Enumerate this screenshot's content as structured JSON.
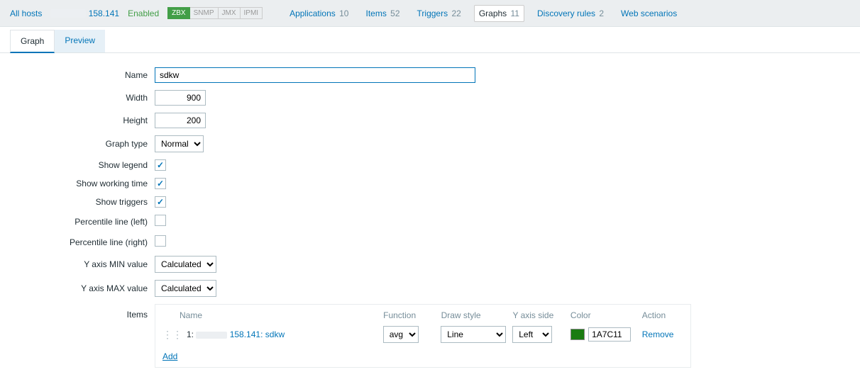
{
  "header": {
    "all_hosts": "All hosts",
    "host_suffix": "158.141",
    "enabled": "Enabled",
    "badges": [
      "ZBX",
      "SNMP",
      "JMX",
      "IPMI"
    ],
    "nav": [
      {
        "label": "Applications",
        "count": "10"
      },
      {
        "label": "Items",
        "count": "52"
      },
      {
        "label": "Triggers",
        "count": "22"
      },
      {
        "label": "Graphs",
        "count": "11",
        "active": true
      },
      {
        "label": "Discovery rules",
        "count": "2"
      },
      {
        "label": "Web scenarios",
        "count": ""
      }
    ]
  },
  "tabs": {
    "graph": "Graph",
    "preview": "Preview"
  },
  "form": {
    "name_label": "Name",
    "name_value": "sdkw",
    "width_label": "Width",
    "width_value": "900",
    "height_label": "Height",
    "height_value": "200",
    "gtype_label": "Graph type",
    "gtype_value": "Normal",
    "legend_label": "Show legend",
    "worktime_label": "Show working time",
    "triggers_label": "Show triggers",
    "pleft_label": "Percentile line (left)",
    "pright_label": "Percentile line (right)",
    "ymin_label": "Y axis MIN value",
    "ymin_value": "Calculated",
    "ymax_label": "Y axis MAX value",
    "ymax_value": "Calculated",
    "items_label": "Items"
  },
  "items": {
    "head": {
      "name": "Name",
      "func": "Function",
      "draw": "Draw style",
      "side": "Y axis side",
      "color": "Color",
      "action": "Action"
    },
    "rows": [
      {
        "idx": "1:",
        "host_suffix": "158.141:",
        "metric": "sdkw",
        "func": "avg",
        "draw": "Line",
        "side": "Left",
        "color_hex": "1A7C11",
        "remove": "Remove"
      }
    ],
    "add": "Add"
  }
}
